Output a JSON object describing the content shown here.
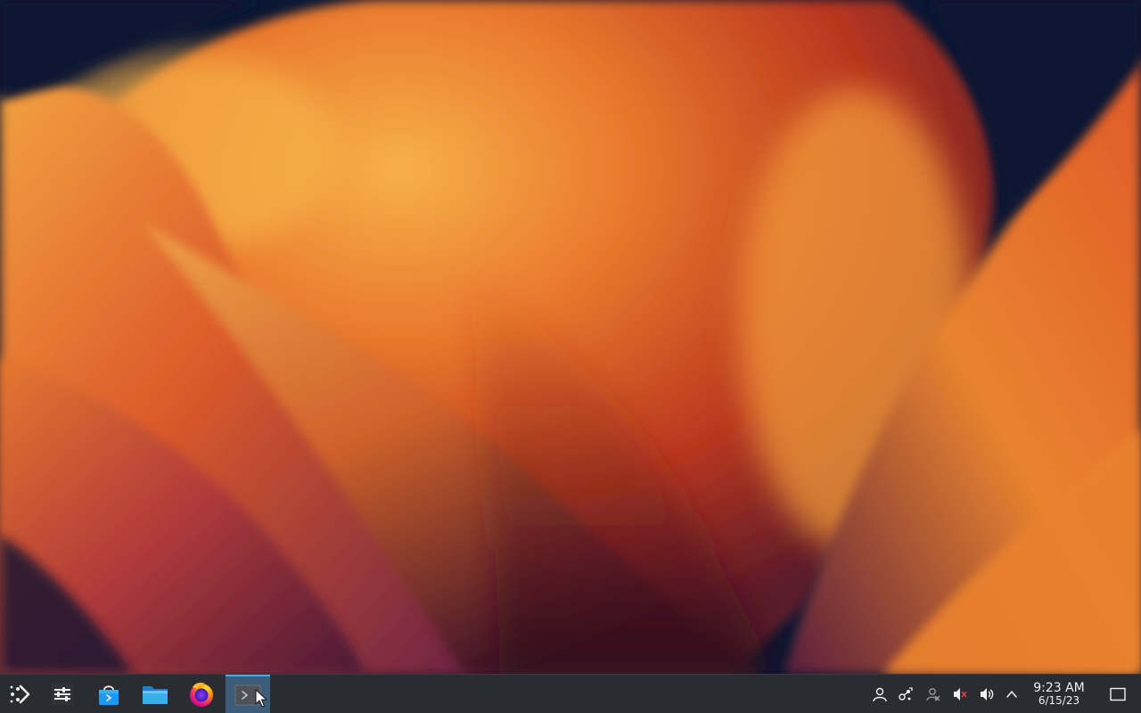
{
  "desktop": {
    "wallpaper": {
      "colors": {
        "background": "#0b1733",
        "orange_light": "#f7a23a",
        "orange": "#e8762c",
        "red": "#b8361f",
        "purple": "#6a2246",
        "shadow": "#2c0c1c"
      }
    }
  },
  "taskbar": {
    "background": "#2a2c31",
    "accent": "#3daee9",
    "launcher": {
      "icon": "kde-application-launcher-icon"
    },
    "pinned": [
      {
        "id": "system-settings",
        "icon": "settings-sliders-icon"
      },
      {
        "id": "discover",
        "icon": "store-bag-icon"
      },
      {
        "id": "dolphin",
        "icon": "folder-icon"
      },
      {
        "id": "firefox",
        "icon": "firefox-icon"
      },
      {
        "id": "konsole",
        "icon": "terminal-icon",
        "active": true
      }
    ],
    "tray": [
      {
        "id": "user",
        "icon": "user-icon"
      },
      {
        "id": "kde-connect",
        "icon": "kde-connect-icon"
      },
      {
        "id": "accounts",
        "icon": "user-disabled-icon"
      },
      {
        "id": "audio-muted",
        "icon": "volume-muted-icon"
      },
      {
        "id": "volume",
        "icon": "volume-icon"
      },
      {
        "id": "expand",
        "icon": "chevron-up-icon"
      }
    ],
    "clock": {
      "time": "9:23 AM",
      "date": "6/15/23"
    },
    "show_desktop": {
      "icon": "show-desktop-icon"
    }
  }
}
